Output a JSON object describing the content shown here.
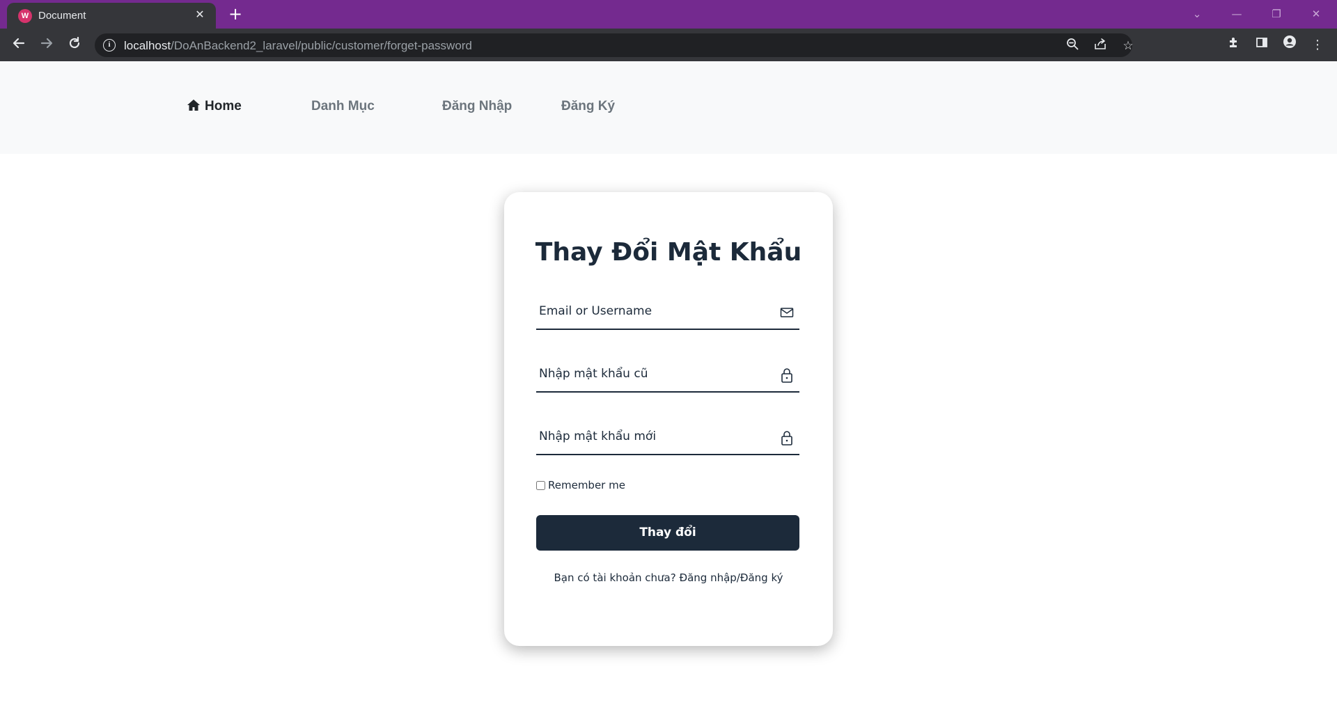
{
  "browser": {
    "tab_title": "Document",
    "url_host": "localhost",
    "url_path": "/DoAnBackend2_laravel/public/customer/forget-password",
    "accent": "#742a8f"
  },
  "nav": {
    "home": "Home",
    "categories": "Danh Mục",
    "login": "Đăng Nhập",
    "register": "Đăng Ký"
  },
  "form": {
    "title": "Thay Đổi Mật Khẩu",
    "email_placeholder": "Email or Username",
    "old_password_placeholder": "Nhập mật khẩu cũ",
    "new_password_placeholder": "Nhập mật khẩu mới",
    "remember_label": "Remember me",
    "submit_label": "Thay đổi",
    "footer_text": "Bạn có tài khoản chưa? Đăng nhập/Đăng ký",
    "primary_color": "#1c2a3a"
  },
  "icons": {
    "email_field": "envelope-icon",
    "password_field": "lock-icon",
    "home": "house-icon"
  }
}
